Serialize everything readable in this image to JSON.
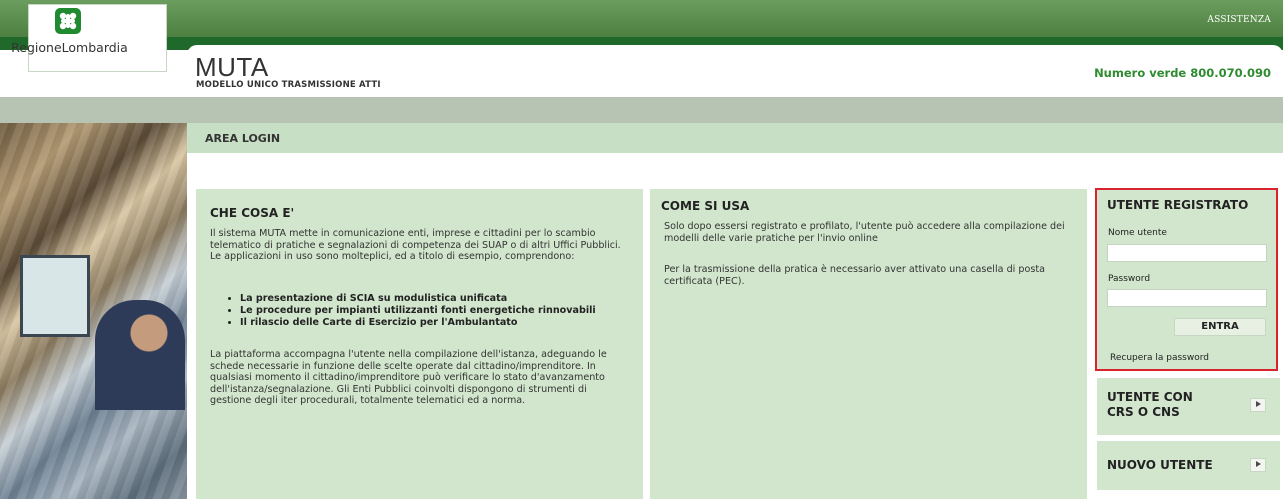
{
  "header": {
    "assist_link": "ASSISTENZA",
    "logo_text": "RegioneLombardia",
    "app_title": "MUTA",
    "app_subtitle": "MODELLO UNICO TRASMISSIONE ATTI",
    "phone": "Numero verde 800.070.090"
  },
  "area": {
    "title": "AREA LOGIN"
  },
  "what_is": {
    "title": "CHE COSA E'",
    "intro": "Il sistema MUTA mette in comunicazione enti, imprese e cittadini per lo scambio telematico di pratiche e segnalazioni di competenza dei SUAP o di altri Uffici Pubblici. Le applicazioni in uso sono molteplici, ed a titolo di esempio, comprendono:",
    "items": [
      "La presentazione di SCIA su modulistica unificata",
      "Le procedure per impianti utilizzanti fonti energetiche rinnovabili",
      "Il rilascio delle Carte di Esercizio per l'Ambulantato"
    ],
    "body": "La piattaforma accompagna l'utente nella compilazione dell'istanza, adeguando le schede necessarie in funzione delle scelte operate dal cittadino/imprenditore. In qualsiasi momento il cittadino/imprenditore può verificare lo stato d'avanzamento dell'istanza/segnalazione. Gli Enti Pubblici coinvolti dispongono di strumenti di gestione degli iter procedurali, totalmente telematici ed a norma."
  },
  "how_to": {
    "title": "COME SI USA",
    "p1": "Solo dopo essersi registrato e profilato, l'utente può accedere alla compilazione dei modelli delle varie pratiche per l'invio online",
    "p2": "Per la trasmissione della pratica è necessario aver attivato una casella di posta certificata (PEC)."
  },
  "login": {
    "title": "UTENTE REGISTRATO",
    "user_label": "Nome utente",
    "user_value": "",
    "password_label": "Password",
    "password_value": "",
    "submit": "ENTRA",
    "recover": "Recupera la password",
    "border_color": "#d9232d"
  },
  "side_buttons": {
    "cns": "UTENTE CON CRS O CNS",
    "new_user": "NUOVO UTENTE"
  },
  "colors": {
    "brand_green": "#1f6a2a",
    "panel_bg": "#d1e6cd",
    "phone_green": "#2e8b30"
  }
}
